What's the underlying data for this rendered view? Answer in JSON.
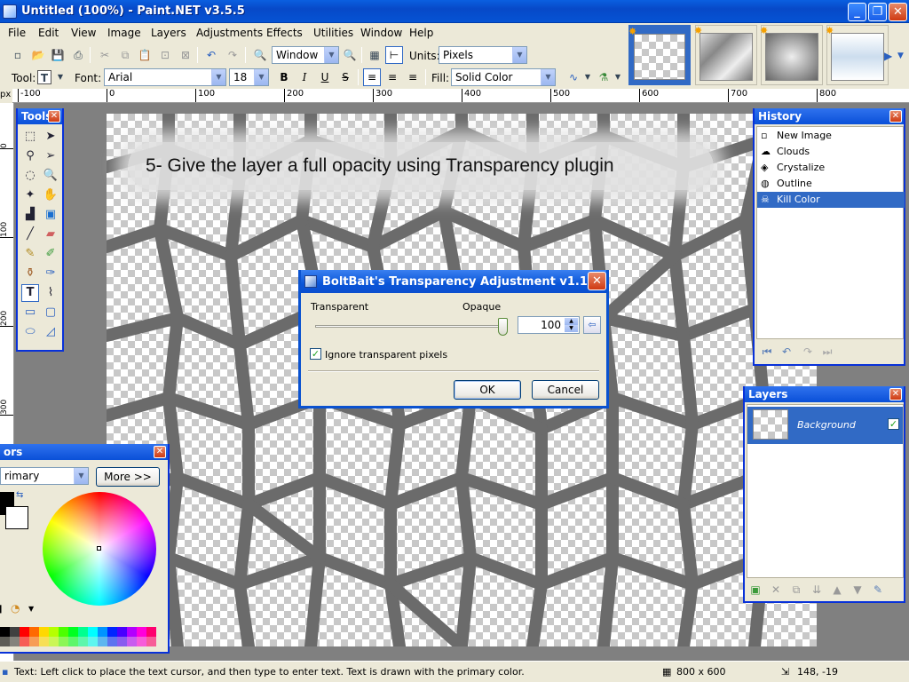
{
  "window": {
    "title": "Untitled (100%) - Paint.NET v3.5.5"
  },
  "menu": [
    "File",
    "Edit",
    "View",
    "Image",
    "Layers",
    "Adjustments",
    "Effects",
    "Utilities",
    "Window",
    "Help"
  ],
  "toolbar": {
    "zoom_value": "Window",
    "units_label": "Units:",
    "units_value": "Pixels",
    "tool_label": "Tool:",
    "font_label": "Font:",
    "font_value": "Arial",
    "size_value": "18",
    "bold": "B",
    "italic": "I",
    "underline": "U",
    "strikethrough": "S",
    "fill_label": "Fill:",
    "fill_value": "Solid Color"
  },
  "ruler": {
    "unit": "px",
    "h_ticks": [
      "-100",
      "0",
      "100",
      "200",
      "300",
      "400",
      "500",
      "600",
      "700",
      "800"
    ],
    "v_ticks": [
      "0",
      "100",
      "200",
      "300"
    ]
  },
  "canvas": {
    "caption": "5- Give the layer a full opacity using Transparency plugin"
  },
  "tools_panel": {
    "title": "Tools",
    "active_tool": "Text"
  },
  "history_panel": {
    "title": "History",
    "items": [
      {
        "label": "New Image",
        "icon": "new-image-icon"
      },
      {
        "label": "Clouds",
        "icon": "clouds-icon"
      },
      {
        "label": "Crystalize",
        "icon": "crystalize-icon"
      },
      {
        "label": "Outline",
        "icon": "outline-icon"
      },
      {
        "label": "Kill Color",
        "icon": "kill-color-icon"
      }
    ],
    "selected": "Kill Color"
  },
  "layers_panel": {
    "title": "Layers",
    "layers": [
      {
        "name": "Background",
        "visible": true
      }
    ]
  },
  "colors_panel": {
    "title": "ors",
    "mode": "rimary",
    "more_button": "More >>"
  },
  "dialog": {
    "title": "BoltBait's Transparency Adjustment v1.1",
    "left_label": "Transparent",
    "right_label": "Opaque",
    "value": "100",
    "slider_fraction": 1.0,
    "checkbox_label": "Ignore transparent pixels",
    "checkbox_checked": true,
    "ok": "OK",
    "cancel": "Cancel"
  },
  "status": {
    "message": "Text: Left click to place the text cursor, and then type to enter text. Text is drawn with the primary color.",
    "image_size": "800 x 600",
    "cursor_position": "148, -19"
  },
  "palette_colors": [
    "#000000",
    "#404040",
    "#ff0000",
    "#ff6a00",
    "#ffd800",
    "#b6ff00",
    "#4cff00",
    "#00ff21",
    "#00ff90",
    "#00ffff",
    "#0094ff",
    "#0026ff",
    "#4800ff",
    "#b200ff",
    "#ff00dc",
    "#ff006e"
  ],
  "accent": "#316ac5"
}
